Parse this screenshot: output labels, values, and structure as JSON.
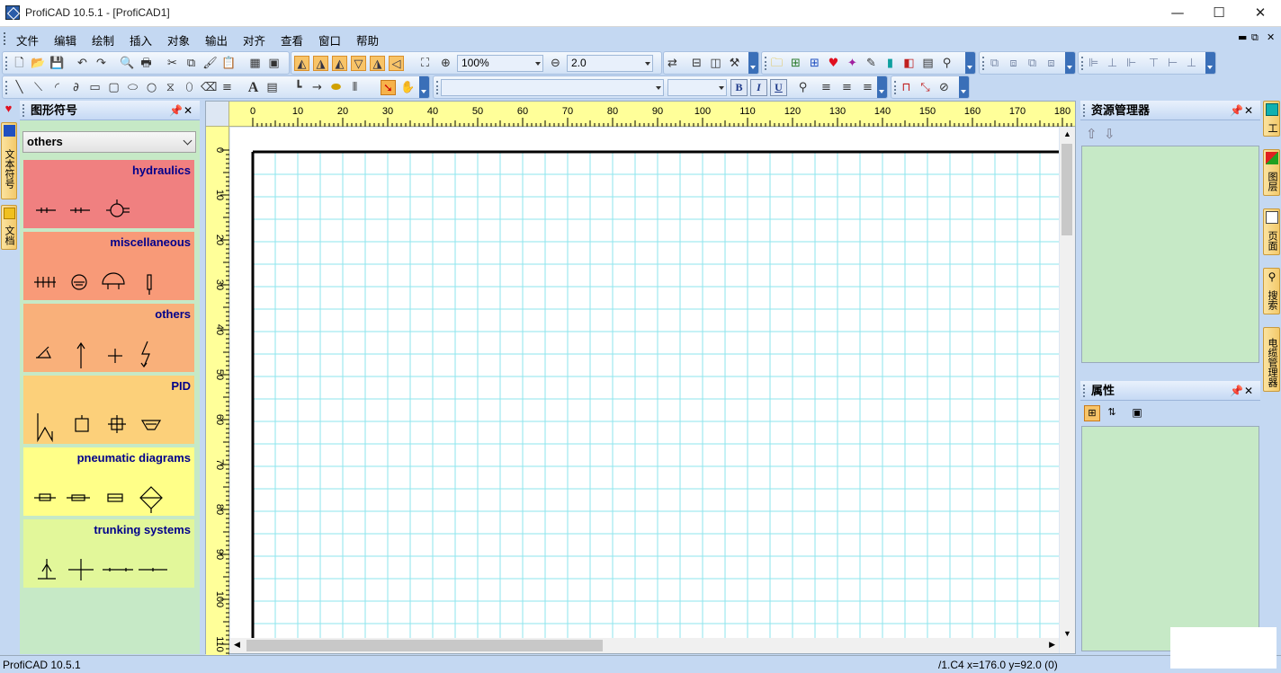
{
  "window": {
    "title": "ProfiCAD 10.5.1 - [ProfiCAD1]"
  },
  "menu": [
    "文件",
    "编辑",
    "绘制",
    "插入",
    "对象",
    "输出",
    "对齐",
    "查看",
    "窗口",
    "帮助"
  ],
  "toolbar": {
    "zoom": "100%",
    "line_width": "2.0",
    "font_name": "",
    "font_size": ""
  },
  "left_tabs": [
    "文本符号",
    "文档"
  ],
  "symbols_panel": {
    "title": "图形符号",
    "selected_category": "others",
    "categories": [
      {
        "name": "hydraulics",
        "color": "#f08080"
      },
      {
        "name": "miscellaneous",
        "color": "#f89a78"
      },
      {
        "name": "others",
        "color": "#f9b07a"
      },
      {
        "name": "PID",
        "color": "#fcd07a"
      },
      {
        "name": "pneumatic diagrams",
        "color": "#ffff88"
      },
      {
        "name": "trunking systems",
        "color": "#e2f79a"
      }
    ]
  },
  "rulers": {
    "horizontal": [
      "0",
      "10",
      "20",
      "30",
      "40",
      "50",
      "60",
      "70",
      "80",
      "90",
      "100",
      "110",
      "120",
      "130",
      "140",
      "150",
      "160",
      "170",
      "180"
    ],
    "vertical": [
      "0",
      "10",
      "20",
      "30",
      "40",
      "50",
      "60",
      "70",
      "80",
      "90",
      "100",
      "110"
    ]
  },
  "resource_panel": {
    "title": "资源管理器"
  },
  "properties_panel": {
    "title": "属性"
  },
  "right_tabs": [
    "工",
    "图层",
    "页面",
    "搜索",
    "电缆管理器"
  ],
  "status": {
    "app": "ProfiCAD 10.5.1",
    "coords": "/1.C4  x=176.0  y=92.0 (0)"
  },
  "colors": {
    "accent": "#c4d8f2",
    "panel_bg": "#c6e9c6",
    "ruler": "#ffff99",
    "grid": "#8ee6ee"
  }
}
